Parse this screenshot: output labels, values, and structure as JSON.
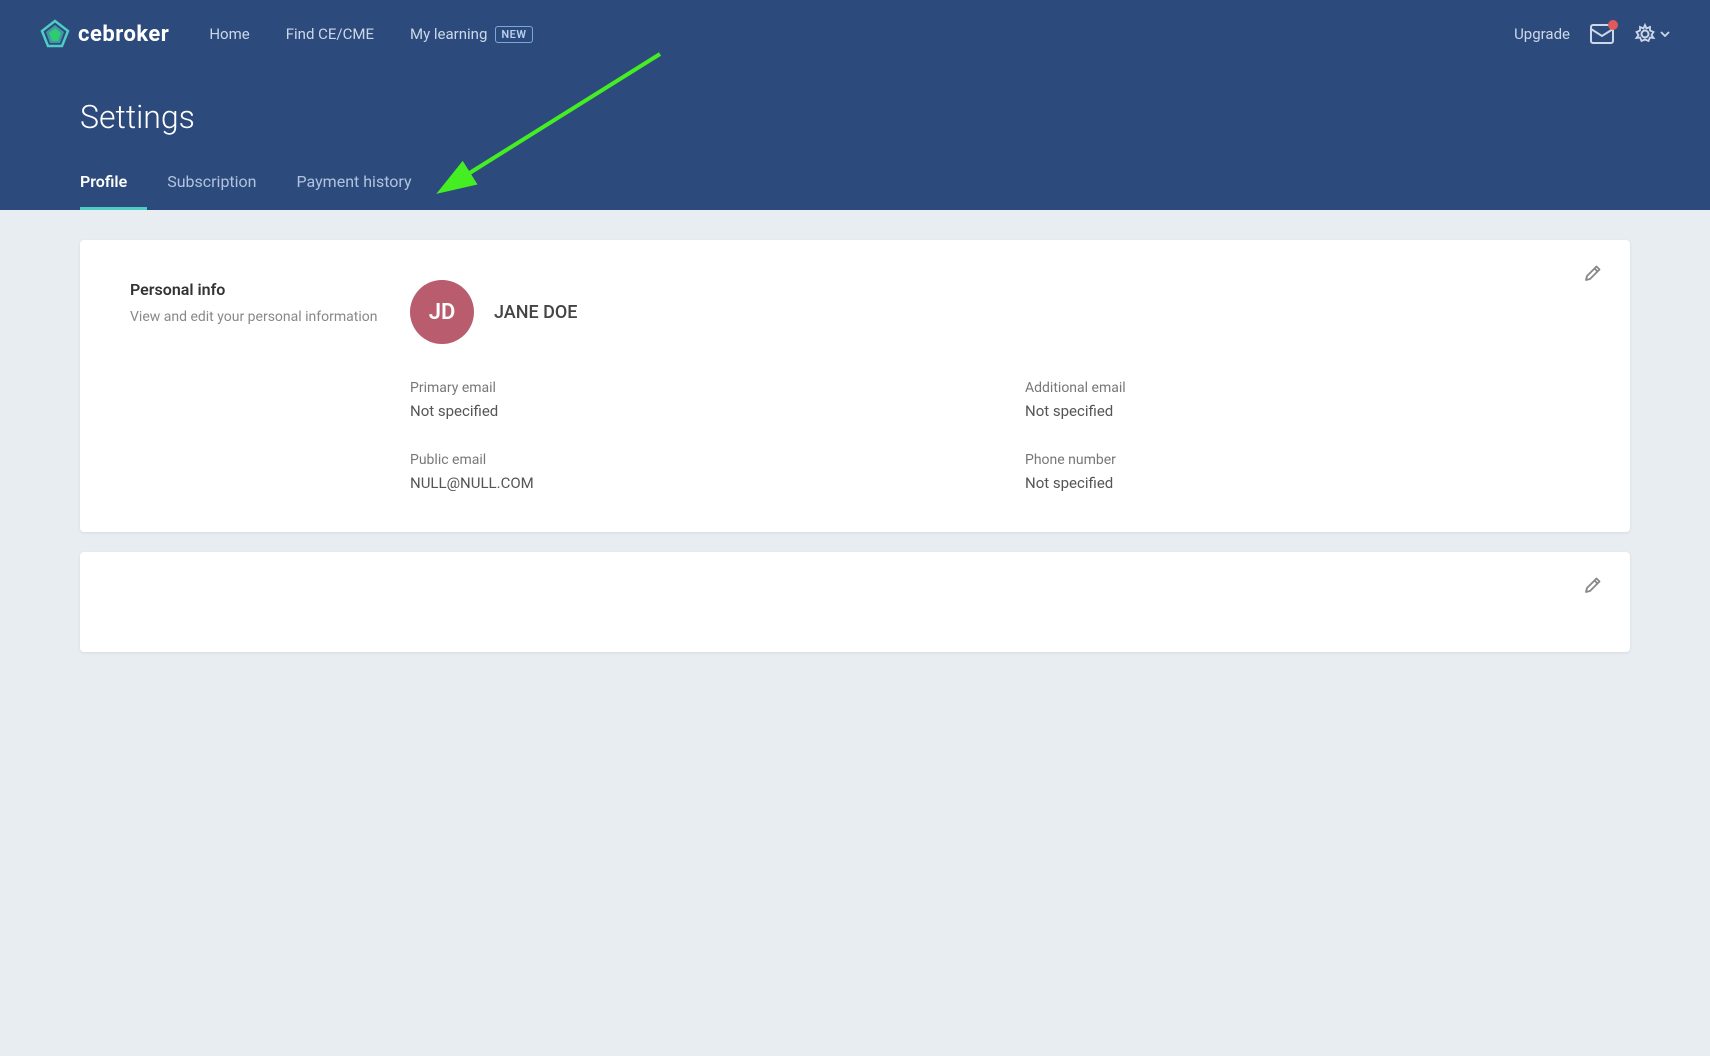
{
  "nav": {
    "logo_text_light": "ce",
    "logo_text_bold": "broker",
    "links": [
      {
        "label": "Home",
        "id": "home"
      },
      {
        "label": "Find CE/CME",
        "id": "find-ce"
      },
      {
        "label": "My learning",
        "id": "my-learning",
        "badge": "NEW"
      }
    ],
    "upgrade": "Upgrade"
  },
  "settings": {
    "title": "Settings",
    "tabs": [
      {
        "label": "Profile",
        "id": "profile",
        "active": true
      },
      {
        "label": "Subscription",
        "id": "subscription",
        "active": false
      },
      {
        "label": "Payment history",
        "id": "payment-history",
        "active": false
      }
    ]
  },
  "personal_info": {
    "section_title": "Personal info",
    "section_desc": "View and edit your personal information",
    "avatar_initials": "JD",
    "user_name": "JANE DOE",
    "fields": [
      {
        "label": "Primary email",
        "value": "Not specified"
      },
      {
        "label": "Additional email",
        "value": "Not specified"
      },
      {
        "label": "Public email",
        "value": "NULL@NULL.COM"
      },
      {
        "label": "Phone number",
        "value": "Not specified"
      }
    ]
  }
}
